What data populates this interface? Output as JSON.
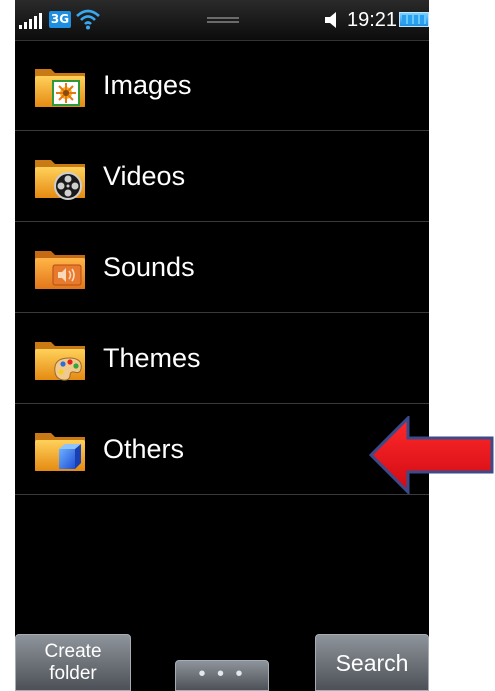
{
  "status_bar": {
    "network": "3G",
    "time": "19:21"
  },
  "folders": [
    {
      "label": "Images",
      "icon": "images-folder-icon"
    },
    {
      "label": "Videos",
      "icon": "videos-folder-icon"
    },
    {
      "label": "Sounds",
      "icon": "sounds-folder-icon"
    },
    {
      "label": "Themes",
      "icon": "themes-folder-icon"
    },
    {
      "label": "Others",
      "icon": "others-folder-icon"
    }
  ],
  "softkeys": {
    "create_folder_line1": "Create",
    "create_folder_line2": "folder",
    "more": "• • •",
    "search": "Search"
  },
  "colors": {
    "background": "#000000",
    "folder": "#f0a020",
    "annotation_arrow": "#e8101c",
    "annotation_arrow_outline": "#3a4a8a"
  }
}
